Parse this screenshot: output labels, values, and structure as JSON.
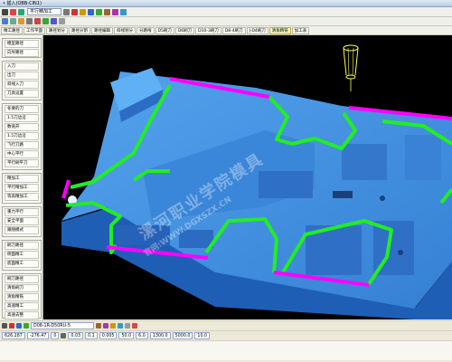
{
  "window": {
    "title": "• 插入(OBB-CIN1)"
  },
  "toolbar1": {
    "dropdown": "平行精加工"
  },
  "toolbar3": {
    "tabs": [
      "精工路径",
      "工作平面",
      "路径划分",
      "路径分割",
      "路径编辑",
      "斜线划分",
      "分路线",
      "D5刷刀",
      "D6刷刀",
      "D10-3刷刀",
      "D8-4刷刀",
      "J-D4刷刀",
      "清角精铣",
      "加工表"
    ]
  },
  "sidebar": {
    "panel1": [
      "模型路径",
      "向导路径"
    ],
    "panel2": [
      "入刀",
      "出刀",
      "斜线入刀",
      "刀具设置"
    ],
    "panel3": [
      "冬要的刀",
      "1.5刀边沿",
      "数值开",
      "1.5刀边沿",
      "飞行刀路",
      "中心平行",
      "平行刷平刀"
    ],
    "panel4": [
      "精加工",
      "平行精加工",
      "等高精加工"
    ],
    "panel5": [
      "重力平行",
      "安全平面",
      "跟随模式"
    ],
    "panel6": [
      "刷刀路径",
      "侧面精工",
      "底面精工"
    ],
    "panel7": [
      "刷刀路径",
      "清角刷刀",
      "清角精铣",
      "高速精工",
      "高速去整"
    ]
  },
  "viewport": {
    "watermark_line1": "漯河职业学院模具",
    "watermark_line2": "官网:WWW.DGXSZX.CN"
  },
  "status": {
    "coords": [
      "626.287",
      "-276.47",
      "0"
    ],
    "field1": "0.03",
    "field2": "0.1",
    "field3": "0.005",
    "field4": "50.0",
    "field5": "6.0",
    "feed": "1300.0",
    "speed": "5000.0",
    "number": "10.0",
    "tool": "D08-1R-D50RU-5"
  },
  "colors": {
    "model": "#3a7fd5",
    "model_top": "#4b97e4",
    "model_dark": "#1e4f9a",
    "toolpath_green": "#22ee22",
    "toolpath_magenta": "#ff00ff",
    "tool_holder": "#ffff55"
  }
}
